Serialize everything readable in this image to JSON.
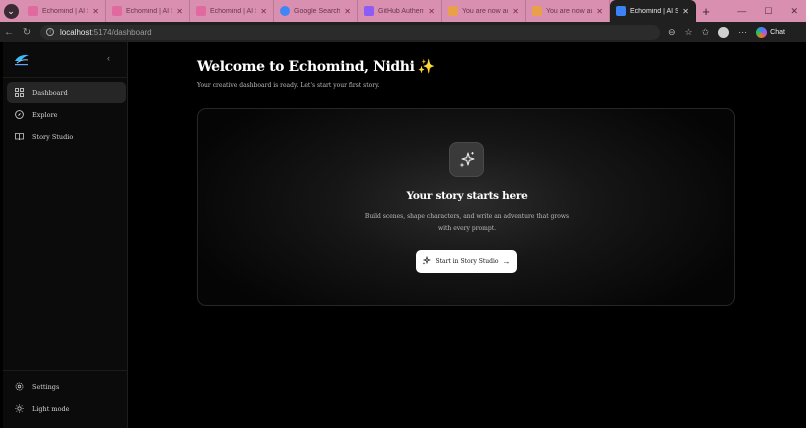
{
  "browser": {
    "tabs": [
      {
        "title": "Echomind | AI Story",
        "favicon_color": "#e06aa0",
        "active": false
      },
      {
        "title": "Echomind | AI Story",
        "favicon_color": "#e06aa0",
        "active": false
      },
      {
        "title": "Echomind | AI Story",
        "favicon_color": "#e06aa0",
        "active": false
      },
      {
        "title": "Google Search - To",
        "favicon_color": "#4285f4",
        "active": false
      },
      {
        "title": "GitHub Authenticat",
        "favicon_color": "#8b5cf6",
        "active": false
      },
      {
        "title": "You are now auth",
        "favicon_color": "#e8a04a",
        "active": false
      },
      {
        "title": "You are now auth",
        "favicon_color": "#e8a04a",
        "active": false
      },
      {
        "title": "Echomind | AI Story",
        "favicon_color": "#3b82f6",
        "active": true
      }
    ],
    "url_host": "localhost",
    "url_path": ":5174/dashboard",
    "chat_label": "Chat"
  },
  "sidebar": {
    "items": [
      {
        "label": "Dashboard",
        "icon": "grid-icon",
        "active": true
      },
      {
        "label": "Explore",
        "icon": "compass-icon",
        "active": false
      },
      {
        "label": "Story Studio",
        "icon": "book-icon",
        "active": false
      }
    ],
    "bottom_items": [
      {
        "label": "Settings",
        "icon": "gear-icon"
      },
      {
        "label": "Light mode",
        "icon": "sun-icon"
      }
    ]
  },
  "main": {
    "welcome": "Welcome to Echomind, Nidhi",
    "welcome_emoji": "✨",
    "subtitle": "Your creative dashboard is ready. Let's start your first story.",
    "card": {
      "title": "Your story starts here",
      "description": "Build scenes, shape characters, and write an adventure that grows with every prompt.",
      "cta_label": "Start in Story Studio"
    }
  },
  "colors": {
    "background": "#000000",
    "tab_strip": "#d98fb0",
    "sidebar": "#0b0b0b",
    "accent_spark": "#f5c542"
  }
}
